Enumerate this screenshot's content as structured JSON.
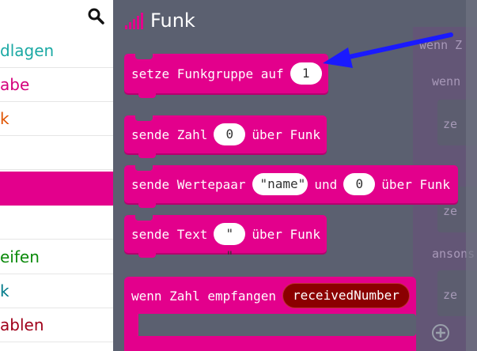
{
  "sidebar": {
    "search_icon": "magnifier-icon",
    "categories": [
      {
        "label": "dlagen",
        "color": "#1ba9a4"
      },
      {
        "label": "abe",
        "color": "#d4007c"
      },
      {
        "label": "k",
        "color": "#e05400"
      },
      {
        "label": "",
        "color": "#e3008c"
      },
      {
        "label": "",
        "color": "#e3008c"
      },
      {
        "label": "",
        "color": "#333333"
      },
      {
        "label": "eifen",
        "color": "#0a8a0a"
      },
      {
        "label": "k",
        "color": "#007a8a"
      },
      {
        "label": "ablen",
        "color": "#a0001a"
      }
    ],
    "selected_index": 4
  },
  "flyout": {
    "title": "Funk",
    "title_icon": "signal-bars-icon",
    "blocks": {
      "set_group": {
        "label": "setze Funkgruppe auf",
        "value": "1"
      },
      "send_number": {
        "prefix": "sende Zahl",
        "value": "0",
        "suffix": "über Funk"
      },
      "send_pair": {
        "prefix": "sende Wertepaar",
        "name_value": "\"name\"",
        "middle": "und",
        "value": "0",
        "suffix": "über Funk"
      },
      "send_text": {
        "prefix": "sende Text",
        "value": "\" \"",
        "suffix": "über Funk"
      },
      "on_received": {
        "label": "wenn Zahl empfangen",
        "variable": "receivedNumber"
      }
    }
  },
  "workspace": {
    "ghost_labels": [
      "wenn Z",
      "wenn",
      "ze",
      "ze",
      "ze",
      "ansons",
      "ze"
    ]
  },
  "colors": {
    "radio_block": "#e3008c",
    "flyout_bg": "#5b6070",
    "arrow": "#1a1aff",
    "variable_pill": "#8b0000"
  }
}
